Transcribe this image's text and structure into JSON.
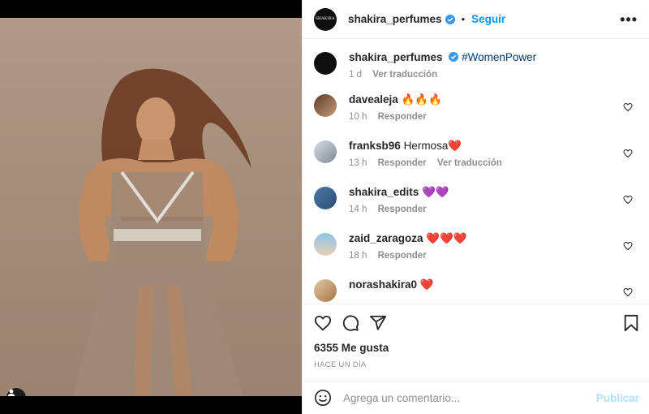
{
  "post": {
    "username": "shakira_perfumes",
    "follow_label": "Seguir",
    "separator": "•",
    "more_label": "•••",
    "logo_text": "SHAKIRA"
  },
  "caption": {
    "username": "shakira_perfumes",
    "text": "#WomenPower",
    "time": "1 d",
    "translate": "Ver traducción"
  },
  "comments": [
    {
      "username": "davealeja",
      "text": "🔥🔥🔥",
      "time": "10 h",
      "reply": "Responder",
      "translate": ""
    },
    {
      "username": "franksb96",
      "text": "Hermosa❤️",
      "time": "13 h",
      "reply": "Responder",
      "translate": "Ver traducción"
    },
    {
      "username": "shakira_edits",
      "text": "💜💜",
      "time": "14 h",
      "reply": "Responder",
      "translate": ""
    },
    {
      "username": "zaid_zaragoza",
      "text": "❤️❤️❤️",
      "time": "18 h",
      "reply": "Responder",
      "translate": ""
    },
    {
      "username": "norashakira0",
      "text": "❤️",
      "time": "",
      "reply": "",
      "translate": ""
    }
  ],
  "likes": "6355 Me gusta",
  "timestamp": "HACE UN DÍA",
  "add_comment": {
    "placeholder": "Agrega un comentario...",
    "post_label": "Publicar"
  },
  "colors": {
    "accent": "#0095f6",
    "verified": "#3897f0",
    "hashtag": "#00376b",
    "muted": "#8e8e8e"
  }
}
